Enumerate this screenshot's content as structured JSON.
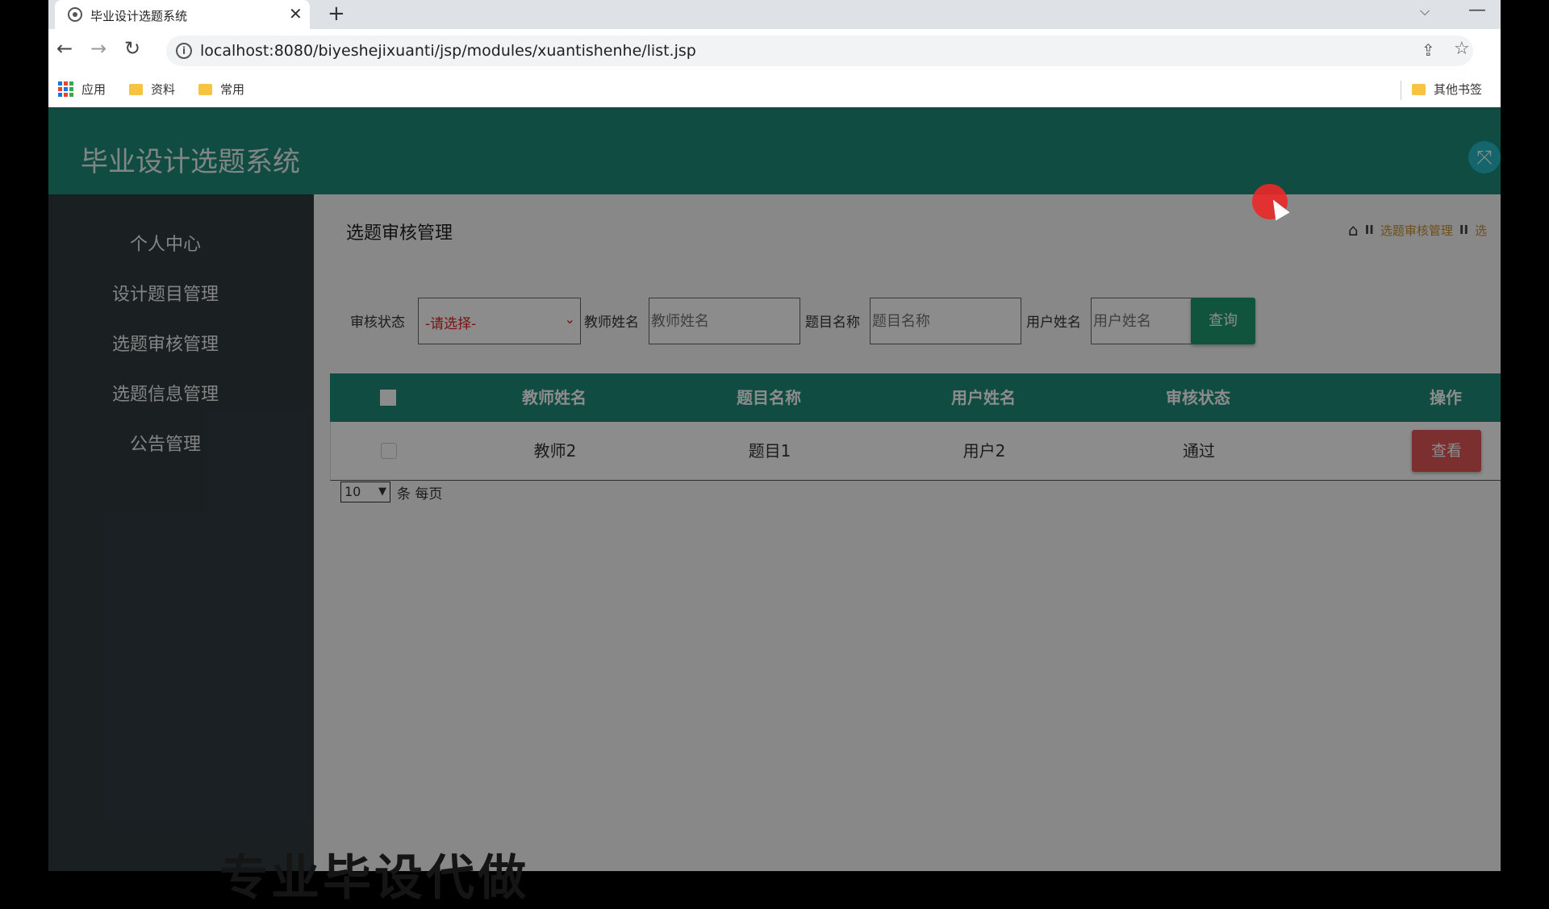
{
  "browser": {
    "tab_title": "毕业设计选题系统",
    "url": "localhost:8080/biyeshejixuanti/jsp/modules/xuantishenhe/list.jsp",
    "bookmarks": [
      "应用",
      "资料",
      "常用"
    ],
    "other_bookmarks": "其他书签"
  },
  "app": {
    "title": "毕业设计选题系统",
    "sidebar": [
      "个人中心",
      "设计题目管理",
      "选题审核管理",
      "选题信息管理",
      "公告管理"
    ],
    "page_title": "选题审核管理",
    "breadcrumb": [
      "选题审核管理",
      "选"
    ],
    "search": {
      "status_label": "审核状态",
      "status_value": "-请选择-",
      "teacher_label": "教师姓名",
      "teacher_placeholder": "教师姓名",
      "topic_label": "题目名称",
      "topic_placeholder": "题目名称",
      "user_label": "用户姓名",
      "user_placeholder": "用户姓名",
      "query_button": "查询"
    },
    "table": {
      "headers": [
        "教师姓名",
        "题目名称",
        "用户姓名",
        "审核状态",
        "操作"
      ],
      "rows": [
        {
          "teacher": "教师2",
          "topic": "题目1",
          "user": "用户2",
          "status": "通过",
          "action": "查看"
        }
      ]
    },
    "pager": {
      "page_size": "10",
      "suffix": "条 每页"
    }
  },
  "watermark": "专业毕设代做",
  "colors": {
    "header": "#1f8a7a",
    "sidebar": "#303a3f",
    "query": "#1e9a72",
    "view": "#e25757",
    "crumb": "#c8912c"
  }
}
